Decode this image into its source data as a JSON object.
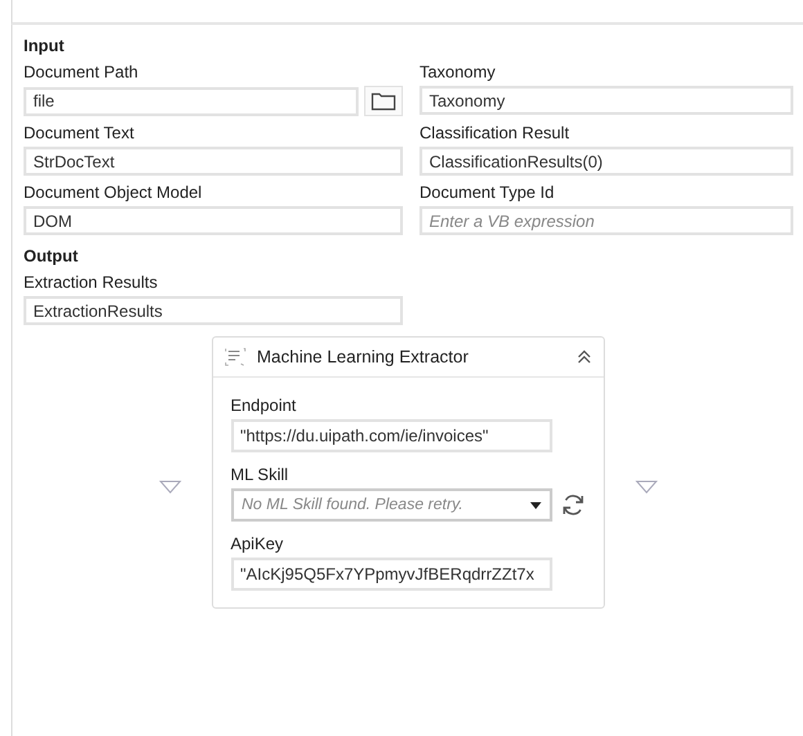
{
  "sections": [
    {
      "title": "Input",
      "fields": [
        {
          "label": "Document Path",
          "value": "file",
          "kind": "browse"
        },
        {
          "label": "Taxonomy",
          "value": "Taxonomy",
          "kind": "text"
        },
        {
          "label": "Document Text",
          "value": "StrDocText",
          "kind": "text"
        },
        {
          "label": "Classification Result",
          "value": "ClassificationResults(0)",
          "kind": "text"
        },
        {
          "label": "Document Object Model",
          "value": "DOM",
          "kind": "text"
        },
        {
          "label": "Document Type Id",
          "placeholder": "Enter a VB expression",
          "kind": "text"
        }
      ]
    },
    {
      "title": "Output",
      "fields": [
        {
          "label": "Extraction Results",
          "value": "ExtractionResults",
          "kind": "text"
        }
      ]
    }
  ],
  "extractor": {
    "title": "Machine Learning Extractor",
    "expanded": true,
    "fields": [
      {
        "label": "Endpoint",
        "value": "\"https://du.uipath.com/ie/invoices\"",
        "kind": "text"
      },
      {
        "label": "ML Skill",
        "placeholder": "No ML Skill found. Please retry.",
        "kind": "dropdown"
      },
      {
        "label": "ApiKey",
        "value": "\"AIcKj95Q5Fx7YPpmyvJfBERqdrrZZt7x",
        "kind": "text"
      }
    ]
  }
}
